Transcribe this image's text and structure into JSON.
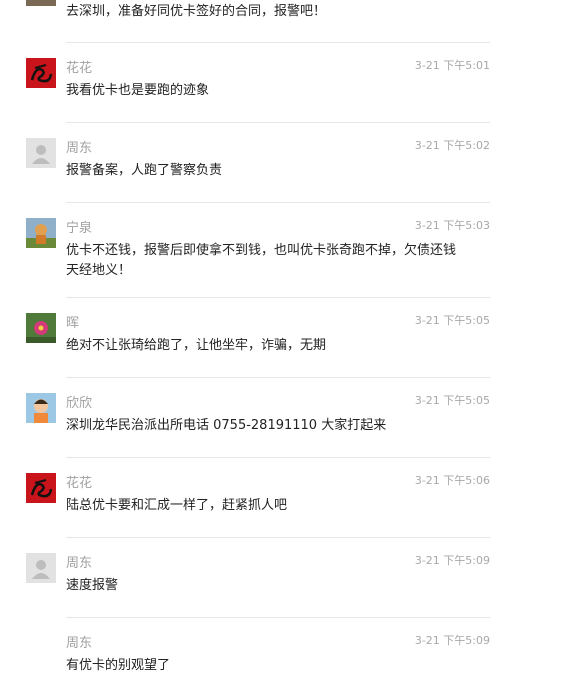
{
  "comments": [
    {
      "name": "",
      "time": "",
      "text": "去深圳，准备好同优卡签好的合同，报警吧！",
      "avatar": "partial-avatar"
    },
    {
      "name": "花花",
      "time": "3-21 下午5:01",
      "text": "我看优卡也是要跑的迹象",
      "avatar": "red-calligraphy-avatar"
    },
    {
      "name": "周东",
      "time": "3-21 下午5:02",
      "text": "报警备案，人跑了警察负责",
      "avatar": "default-user-avatar"
    },
    {
      "name": "宁泉",
      "time": "3-21 下午5:03",
      "text": "优卡不还钱，报警后即使拿不到钱，也叫优卡张奇跑不掉，欠债还钱天经地义！",
      "avatar": "photo-avatar"
    },
    {
      "name": "晖",
      "time": "3-21 下午5:05",
      "text": "绝对不让张琦给跑了，让他坐牢，诈骗，无期",
      "avatar": "flower-avatar"
    },
    {
      "name": "欣欣",
      "time": "3-21 下午5:05",
      "text": "深圳龙华民治派出所电话  0755-28191110  大家打起来",
      "avatar": "child-photo-avatar"
    },
    {
      "name": "花花",
      "time": "3-21 下午5:06",
      "text": "陆总优卡要和汇成一样了，赶紧抓人吧",
      "avatar": "red-calligraphy-avatar"
    },
    {
      "name": "周东",
      "time": "3-21 下午5:09",
      "text": "速度报警",
      "avatar": "default-user-avatar"
    },
    {
      "name": "周东",
      "time": "3-21 下午5:09",
      "text": "有优卡的别观望了",
      "avatar": "none"
    }
  ]
}
